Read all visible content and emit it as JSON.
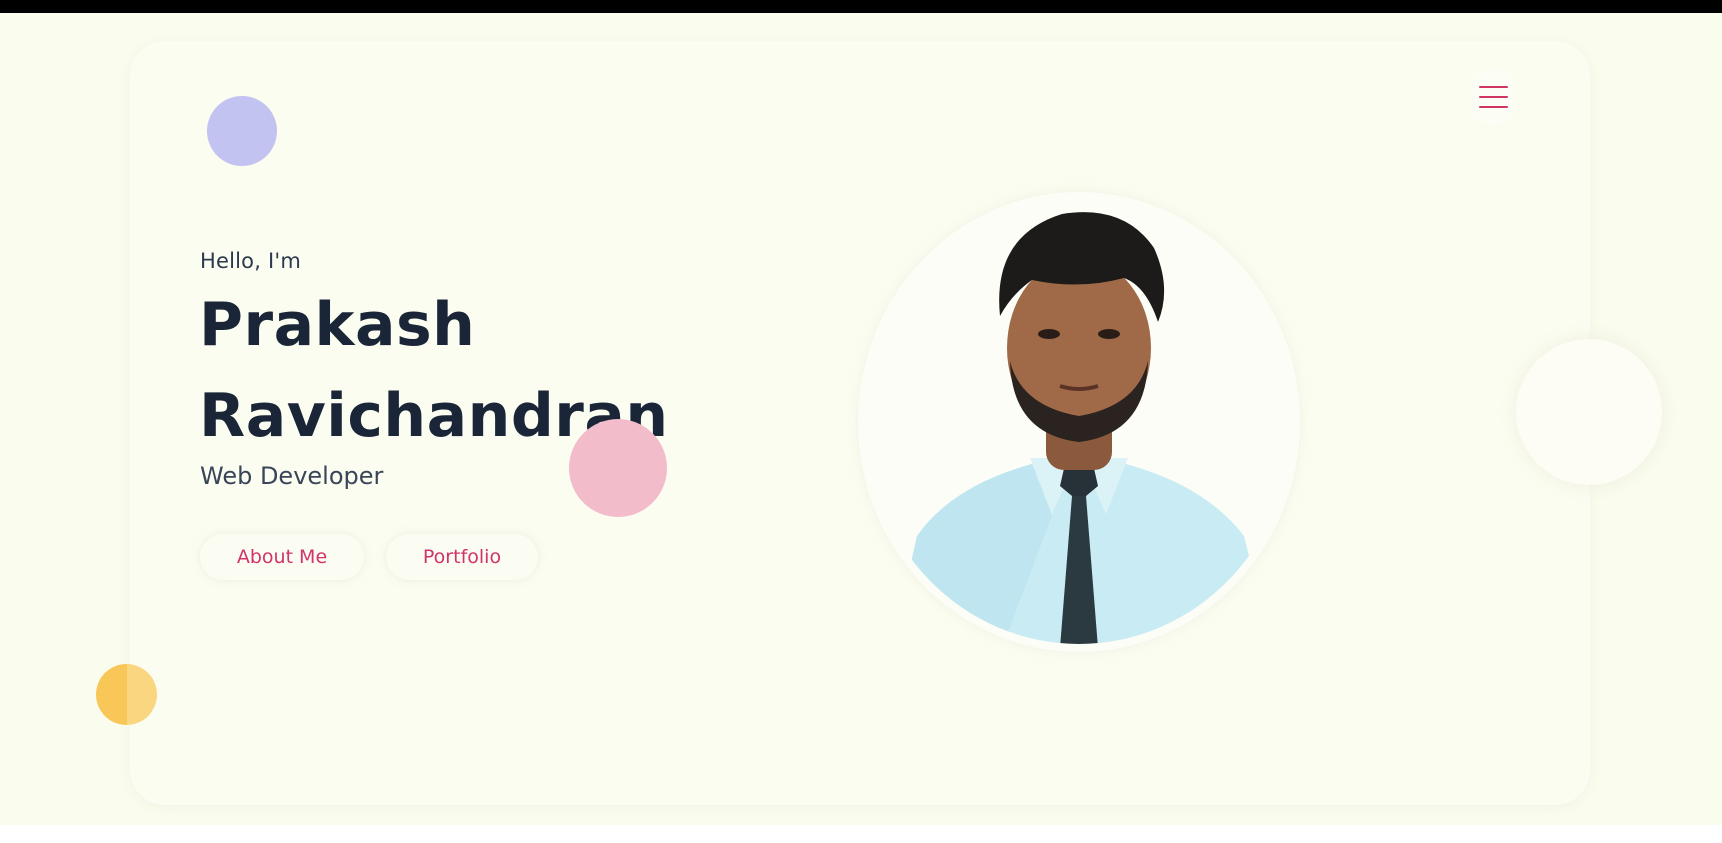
{
  "hero": {
    "greeting": "Hello, I'm",
    "name_line1": "Prakash",
    "name_line2": "Ravichandran",
    "role": "Web Developer"
  },
  "buttons": {
    "about_label": "About Me",
    "portfolio_label": "Portfolio"
  },
  "icons": {
    "menu": "hamburger-menu-icon"
  },
  "colors": {
    "background": "#fafcee",
    "accent": "#d1336a",
    "heading": "#1a2638",
    "deco_purple": "#c3c3f1",
    "deco_pink": "#f2bccb",
    "deco_yellow": "#f8c757"
  }
}
